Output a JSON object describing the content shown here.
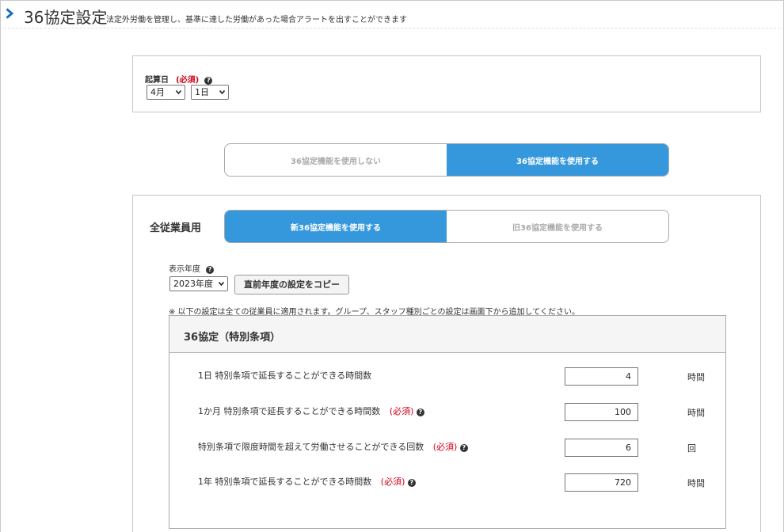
{
  "header": {
    "title": "36協定設定",
    "subtitle": "法定外労働を管理し、基準に達した労働があった場合アラートを出すことができます"
  },
  "start_date": {
    "label": "起算日",
    "required": "(必須)",
    "month_value": "4月",
    "day_value": "1日"
  },
  "usage_toggle": {
    "off_label": "36協定機能を使用しない",
    "on_label": "36協定機能を使用する",
    "selected": "on"
  },
  "all_employees": {
    "label": "全従業員用",
    "version_toggle": {
      "new_label": "新36協定機能を使用する",
      "old_label": "旧36協定機能を使用する",
      "selected": "new"
    },
    "year_label": "表示年度",
    "year_value": "2023年度",
    "copy_button": "直前年度の設定をコピー",
    "note": "※ 以下の設定は全ての従業員に適用されます。グループ、スタッフ種別ごとの設定は画面下から追加してください。"
  },
  "special_clause": {
    "title": "36協定（特別条項）",
    "rows": [
      {
        "label": "1日 特別条項で延長することができる時間数",
        "required": "",
        "value": "4",
        "unit": "時間"
      },
      {
        "label": "1か月 特別条項で延長することができる時間数",
        "required": "(必須)",
        "value": "100",
        "unit": "時間"
      },
      {
        "label": "特別条項で限度時間を超えて労働させることができる回数",
        "required": "(必須)",
        "value": "6",
        "unit": "回"
      },
      {
        "label": "1年 特別条項で延長することができる時間数",
        "required": "(必須)",
        "value": "720",
        "unit": "時間"
      }
    ]
  },
  "colors": {
    "accent": "#3598dc",
    "required": "#d0021b",
    "header_chevron": "#1a6fc4"
  }
}
